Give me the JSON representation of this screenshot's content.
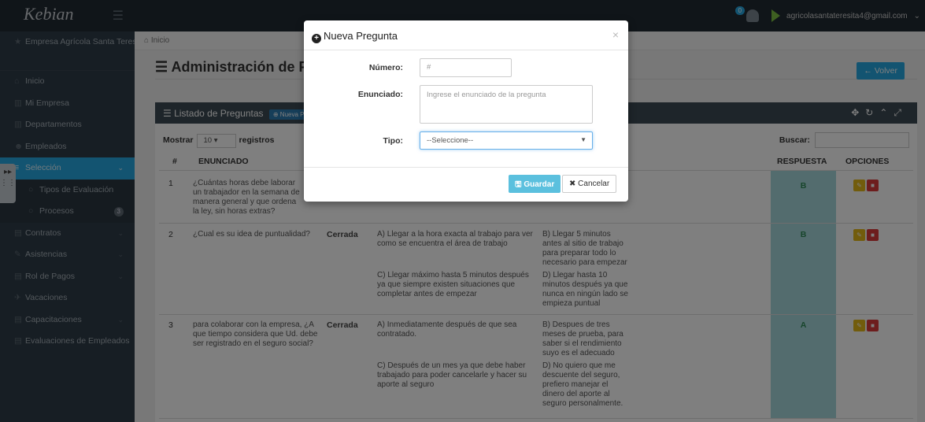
{
  "app": {
    "logo": "Kebian",
    "user_email": "agricolasantateresita4@gmail.com",
    "notif_count": "0"
  },
  "sidebar": {
    "company": "Empresa Agrícola Santa Teresita",
    "items": [
      {
        "label": "Inicio"
      },
      {
        "label": "Mi Empresa"
      },
      {
        "label": "Departamentos"
      },
      {
        "label": "Empleados"
      },
      {
        "label": "Selección"
      },
      {
        "label": "Tipos de Evaluación"
      },
      {
        "label": "Procesos",
        "count": "3"
      },
      {
        "label": "Contratos"
      },
      {
        "label": "Asistencias"
      },
      {
        "label": "Rol de Pagos"
      },
      {
        "label": "Vacaciones"
      },
      {
        "label": "Capacitaciones"
      },
      {
        "label": "Evaluaciones de Empleados"
      }
    ]
  },
  "breadcrumb": "Inicio",
  "page": {
    "title": "Administración de Preguntas",
    "back_label": "Volver"
  },
  "panel": {
    "title": "Listado de Preguntas",
    "new_label": "Nueva Pregunta"
  },
  "table": {
    "show_label": "Mostrar",
    "show_value": "10",
    "records_label": "registros",
    "search_label": "Buscar:",
    "headers": {
      "num": "#",
      "statement": "ENUNCIADO",
      "answer": "RESPUESTA",
      "options": "OPCIONES"
    },
    "rows": [
      {
        "num": "1",
        "statement": "¿Cuántas horas debe laborar un trabajador en la semana de manera general y que ordena la ley, sin horas extras?",
        "type": "",
        "opt_a": "",
        "opt_b": "",
        "opt_c": "",
        "opt_d": "",
        "answer": "B"
      },
      {
        "num": "2",
        "statement": "¿Cual es su idea de puntualidad?",
        "type": "Cerrada",
        "opt_a": "A) Llegar a la hora exacta al trabajo para ver como se encuentra el área de trabajo",
        "opt_b": "B) Llegar 5 minutos antes al sitio de trabajo para preparar todo lo necesario para empezar",
        "opt_c": "C) Llegar máximo hasta 5 minutos después ya que siempre existen situaciones que completar antes de empezar",
        "opt_d": "D) Llegar hasta 10 minutos después ya que nunca en ningún lado se empieza puntual",
        "answer": "B"
      },
      {
        "num": "3",
        "statement": "para colaborar con la empresa, ¿A que tiempo considera que Ud. debe ser registrado en el seguro social?",
        "type": "Cerrada",
        "opt_a": "A) Inmediatamente después de que sea contratado.",
        "opt_b": "B) Despues de tres meses de prueba, para saber si el rendimiento suyo es el adecuado",
        "opt_c": "C) Después de un mes ya que debe haber trabajado para poder cancelarle y hacer su aporte al seguro",
        "opt_d": "D) No quiero que me descuente del seguro, prefiero manejar el dinero del aporte al seguro personalmente.",
        "answer": "A"
      }
    ]
  },
  "modal": {
    "title": "Nueva Pregunta",
    "number_label": "Número:",
    "number_placeholder": "#",
    "statement_label": "Enunciado:",
    "statement_placeholder": "Ingrese el enunciado de la pregunta",
    "type_label": "Tipo:",
    "type_value": "--Seleccione--",
    "save_label": "Guardar",
    "cancel_label": "Cancelar"
  }
}
